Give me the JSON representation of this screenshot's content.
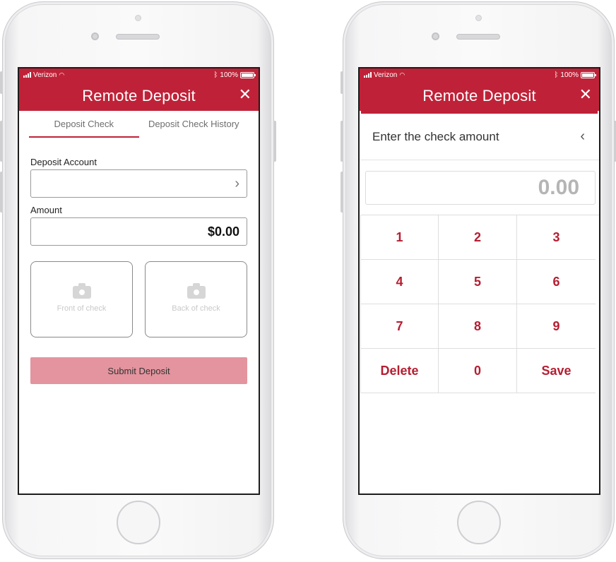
{
  "colors": {
    "brand": "#bf2238",
    "submit_disabled": "#e3949e",
    "key_text": "#b51e31"
  },
  "status_bar": {
    "carrier": "Verizon",
    "battery": "100%",
    "signal_icon": "signal-bars-icon",
    "wifi_icon": "wifi-icon",
    "bluetooth_icon": "bluetooth-icon",
    "battery_icon": "battery-icon"
  },
  "left": {
    "app_title": "Remote Deposit",
    "close_icon": "close-icon",
    "close_glyph": "✕",
    "tabs": [
      {
        "label": "Deposit Check",
        "active": true
      },
      {
        "label": "Deposit Check History",
        "active": false
      }
    ],
    "deposit_account": {
      "label": "Deposit Account",
      "value": "",
      "chevron": "›"
    },
    "amount": {
      "label": "Amount",
      "value": "$0.00"
    },
    "front_check": {
      "label": "Front of check",
      "icon": "camera-icon"
    },
    "back_check": {
      "label": "Back of check",
      "icon": "camera-icon"
    },
    "submit_label": "Submit Deposit"
  },
  "right": {
    "app_title": "Remote Deposit",
    "close_glyph": "✕",
    "prompt": "Enter the check amount",
    "back_glyph": "‹",
    "amount_display": "0.00",
    "keys": [
      "1",
      "2",
      "3",
      "4",
      "5",
      "6",
      "7",
      "8",
      "9",
      "Delete",
      "0",
      "Save"
    ]
  }
}
